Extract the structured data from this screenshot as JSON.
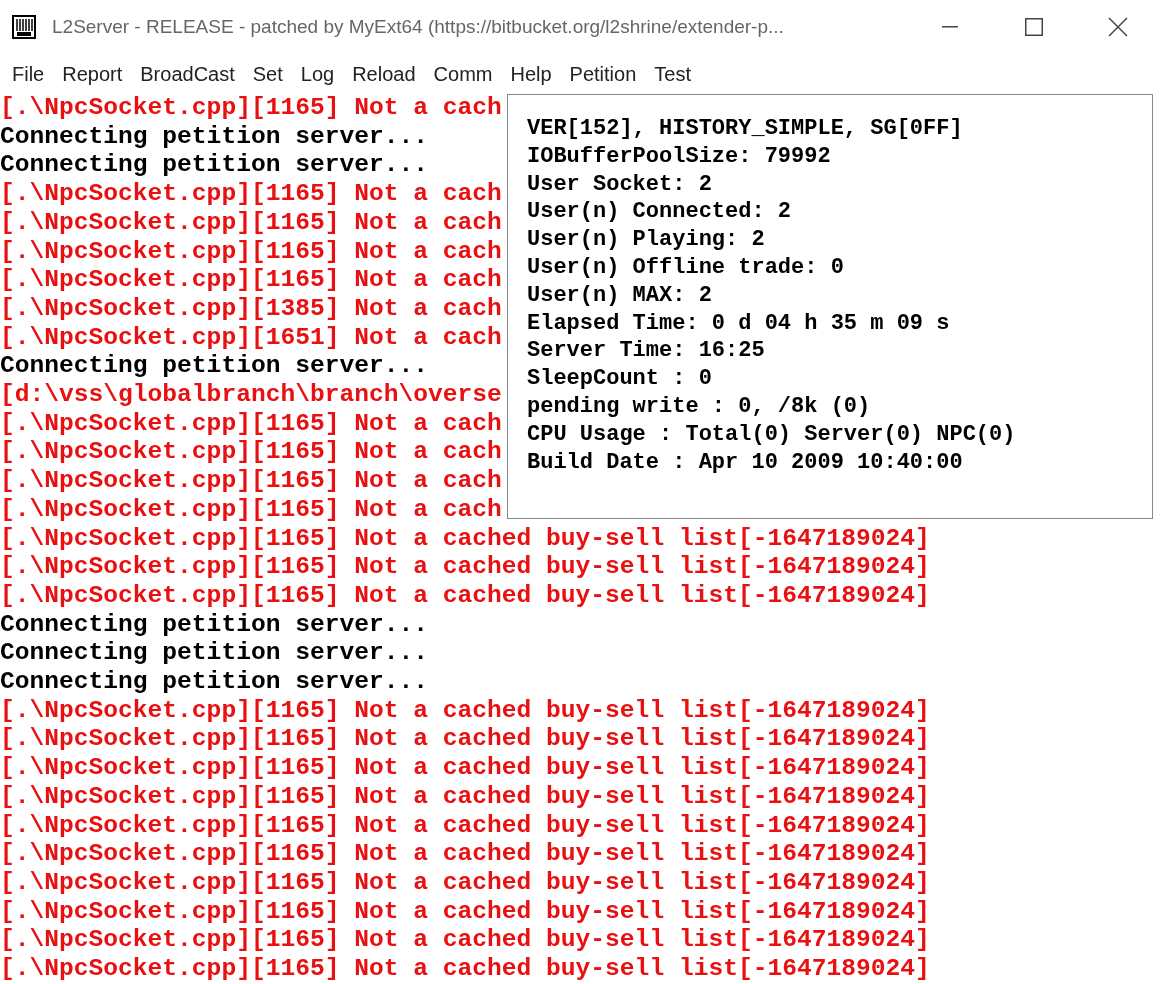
{
  "window": {
    "title": "L2Server - RELEASE - patched by MyExt64 (https://bitbucket.org/l2shrine/extender-p..."
  },
  "menu": [
    "File",
    "Report",
    "BroadCast",
    "Set",
    "Log",
    "Reload",
    "Comm",
    "Help",
    "Petition",
    "Test"
  ],
  "log": [
    {
      "kind": "error",
      "text": "[.\\NpcSocket.cpp][1165] Not a cach"
    },
    {
      "kind": "info",
      "text": "Connecting petition server..."
    },
    {
      "kind": "info",
      "text": "Connecting petition server..."
    },
    {
      "kind": "error",
      "text": "[.\\NpcSocket.cpp][1165] Not a cach"
    },
    {
      "kind": "error",
      "text": "[.\\NpcSocket.cpp][1165] Not a cach"
    },
    {
      "kind": "error",
      "text": "[.\\NpcSocket.cpp][1165] Not a cach"
    },
    {
      "kind": "error",
      "text": "[.\\NpcSocket.cpp][1165] Not a cach"
    },
    {
      "kind": "error",
      "text": "[.\\NpcSocket.cpp][1385] Not a cach"
    },
    {
      "kind": "error",
      "text": "[.\\NpcSocket.cpp][1651] Not a cach"
    },
    {
      "kind": "info",
      "text": "Connecting petition server..."
    },
    {
      "kind": "error",
      "text": "[d:\\vss\\globalbranch\\branch\\overse"
    },
    {
      "kind": "error",
      "text": "[.\\NpcSocket.cpp][1165] Not a cach"
    },
    {
      "kind": "error",
      "text": "[.\\NpcSocket.cpp][1165] Not a cach"
    },
    {
      "kind": "error",
      "text": "[.\\NpcSocket.cpp][1165] Not a cach"
    },
    {
      "kind": "error",
      "text": "[.\\NpcSocket.cpp][1165] Not a cach"
    },
    {
      "kind": "error",
      "text": "[.\\NpcSocket.cpp][1165] Not a cached buy-sell list[-1647189024]"
    },
    {
      "kind": "error",
      "text": "[.\\NpcSocket.cpp][1165] Not a cached buy-sell list[-1647189024]"
    },
    {
      "kind": "error",
      "text": "[.\\NpcSocket.cpp][1165] Not a cached buy-sell list[-1647189024]"
    },
    {
      "kind": "info",
      "text": "Connecting petition server..."
    },
    {
      "kind": "info",
      "text": "Connecting petition server..."
    },
    {
      "kind": "info",
      "text": "Connecting petition server..."
    },
    {
      "kind": "error",
      "text": "[.\\NpcSocket.cpp][1165] Not a cached buy-sell list[-1647189024]"
    },
    {
      "kind": "error",
      "text": "[.\\NpcSocket.cpp][1165] Not a cached buy-sell list[-1647189024]"
    },
    {
      "kind": "error",
      "text": "[.\\NpcSocket.cpp][1165] Not a cached buy-sell list[-1647189024]"
    },
    {
      "kind": "error",
      "text": "[.\\NpcSocket.cpp][1165] Not a cached buy-sell list[-1647189024]"
    },
    {
      "kind": "error",
      "text": "[.\\NpcSocket.cpp][1165] Not a cached buy-sell list[-1647189024]"
    },
    {
      "kind": "error",
      "text": "[.\\NpcSocket.cpp][1165] Not a cached buy-sell list[-1647189024]"
    },
    {
      "kind": "error",
      "text": "[.\\NpcSocket.cpp][1165] Not a cached buy-sell list[-1647189024]"
    },
    {
      "kind": "error",
      "text": "[.\\NpcSocket.cpp][1165] Not a cached buy-sell list[-1647189024]"
    },
    {
      "kind": "error",
      "text": "[.\\NpcSocket.cpp][1165] Not a cached buy-sell list[-1647189024]"
    },
    {
      "kind": "error",
      "text": "[.\\NpcSocket.cpp][1165] Not a cached buy-sell list[-1647189024]"
    }
  ],
  "status_panel": [
    "VER[152], HISTORY_SIMPLE, SG[0FF]",
    "IOBufferPoolSize: 79992",
    "User Socket: 2",
    "User(n) Connected: 2",
    "User(n) Playing: 2",
    "User(n) Offline trade: 0",
    "User(n) MAX: 2",
    "Elapsed Time: 0 d 04 h 35 m 09 s",
    "Server Time: 16:25",
    "SleepCount : 0",
    "pending write : 0, /8k (0)",
    "CPU Usage : Total(0) Server(0) NPC(0)",
    "Build Date : Apr 10 2009 10:40:00"
  ]
}
